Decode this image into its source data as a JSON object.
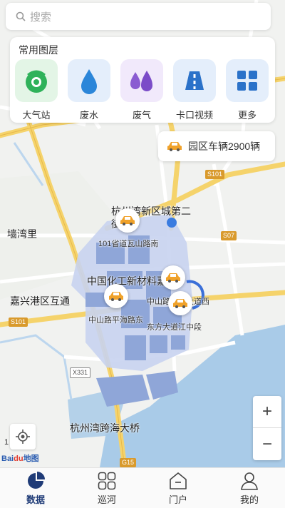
{
  "search": {
    "placeholder": "搜索"
  },
  "layers": {
    "title": "常用图层",
    "items": [
      {
        "label": "大气站",
        "icon": "air-station-icon"
      },
      {
        "label": "废水",
        "icon": "wastewater-icon"
      },
      {
        "label": "废气",
        "icon": "exhaust-gas-icon"
      },
      {
        "label": "卡口视频",
        "icon": "checkpoint-video-icon"
      },
      {
        "label": "更多",
        "icon": "grid-more-icon"
      }
    ]
  },
  "vehicle_chip": {
    "label": "园区车辆2900辆"
  },
  "map": {
    "labels": {
      "district_top": "杭州湾新区城第二",
      "district_top2": "街",
      "road_101": "101省道瓦山路南",
      "wanwan": "墙湾里",
      "chem": "中国化工新材料嘉兴",
      "zhongshan_east": "中山路东方大道西",
      "zhongshan_ping": "中山路平海路东",
      "dongfang": "东方大道江中段",
      "jiaxing_port": "嘉兴港区互通",
      "bridge": "杭州湾跨海大桥",
      "hanghan": "杭州湾"
    },
    "badges": {
      "s101_top": "S101",
      "s07": "S07",
      "s101_left": "S101",
      "x331": "X331",
      "g15": "G15"
    },
    "scale_number": "1",
    "brand": {
      "bai": "Bai",
      "du": "du",
      "map": "地图"
    }
  },
  "zoom": {
    "in": "+",
    "out": "−"
  },
  "tabs": [
    {
      "label": "数据",
      "icon": "data-pie-icon",
      "active": true
    },
    {
      "label": "巡河",
      "icon": "patrol-grid-icon",
      "active": false
    },
    {
      "label": "门户",
      "icon": "portal-home-icon",
      "active": false
    },
    {
      "label": "我的",
      "icon": "profile-icon",
      "active": false
    }
  ],
  "colors": {
    "accent_navy": "#1f3b77",
    "road_yellow": "#f5d36b",
    "water": "#a9cbe8",
    "industrial": "#8fa6d8",
    "car_orange": "#f0a22a"
  }
}
